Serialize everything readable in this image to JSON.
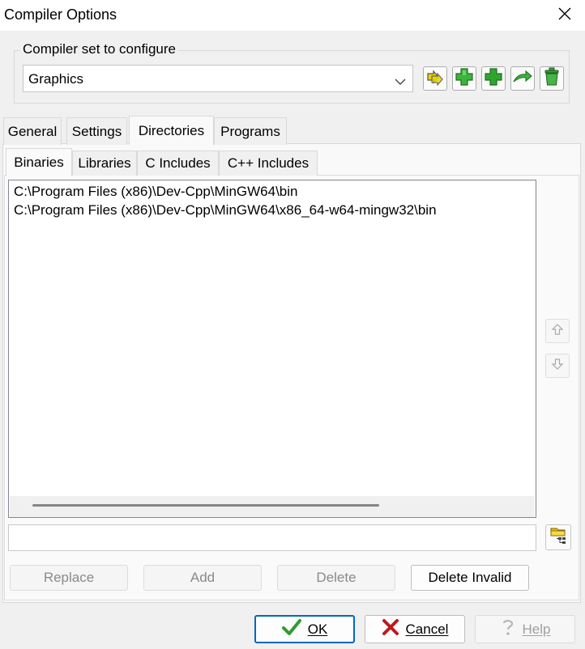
{
  "window": {
    "title": "Compiler Options"
  },
  "compiler_set": {
    "group_label": "Compiler set to configure",
    "selected": "Graphics"
  },
  "toolbar": {
    "icons": [
      "find-compilers-icon",
      "add-compiler-icon",
      "add-blank-compiler-icon",
      "rename-compiler-icon",
      "delete-compiler-icon"
    ]
  },
  "tabs": [
    {
      "label": "General",
      "active": false
    },
    {
      "label": "Settings",
      "active": false
    },
    {
      "label": "Directories",
      "active": true
    },
    {
      "label": "Programs",
      "active": false
    }
  ],
  "subtabs": [
    {
      "label": "Binaries",
      "active": true
    },
    {
      "label": "Libraries",
      "active": false
    },
    {
      "label": "C Includes",
      "active": false
    },
    {
      "label": "C++ Includes",
      "active": false
    }
  ],
  "directories": [
    "C:\\Program Files (x86)\\Dev-Cpp\\MinGW64\\bin",
    "C:\\Program Files (x86)\\Dev-Cpp\\MinGW64\\x86_64-w64-mingw32\\bin"
  ],
  "path_input": {
    "value": ""
  },
  "actions": {
    "replace": "Replace",
    "add": "Add",
    "delete": "Delete",
    "delete_invalid": "Delete Invalid"
  },
  "dialog_buttons": {
    "ok": "OK",
    "cancel": "Cancel",
    "help": "Help"
  },
  "colors": {
    "ok_check": "#2e9c2e",
    "cancel_x": "#c0181f",
    "default_border": "#0067c0"
  }
}
